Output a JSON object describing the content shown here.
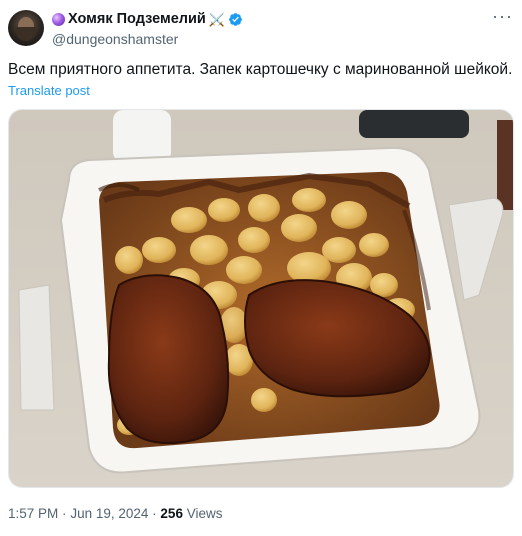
{
  "post": {
    "display_name": "Хомяк Подземелий",
    "name_emoji": "⚔️",
    "handle": "@dungeonshamster",
    "text": "Всем приятного аппетита. Запек картошечку с маринованной шейкой.",
    "translate_label": "Translate post",
    "time": "1:57 PM",
    "separator": "·",
    "date": "Jun 19, 2024",
    "views_count": "256",
    "views_label": "Views"
  },
  "icons": {
    "avatar": "avatar-photo",
    "orb": "purple-orb-icon",
    "verified": "verified-badge-icon",
    "more": "more-options-icon"
  },
  "colors": {
    "link": "#1d9bf0",
    "secondary_text": "#536471",
    "verified": "#1d9bf0"
  }
}
